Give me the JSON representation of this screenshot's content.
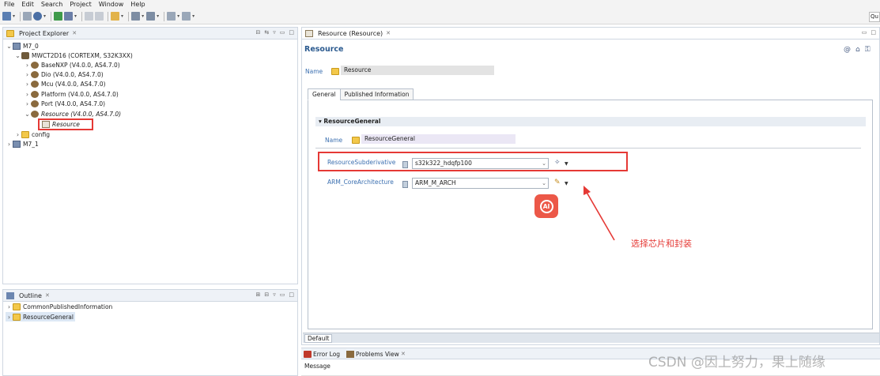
{
  "menubar": {
    "items": [
      "File",
      "Edit",
      "Search",
      "Project",
      "Window",
      "Help"
    ]
  },
  "toolbar": {
    "quick_access": "Qu"
  },
  "project_explorer": {
    "title": "Project Explorer",
    "tree": [
      {
        "label": "M7_0"
      },
      {
        "label": "MWCT2D16 (CORTEXM, S32K3XX)"
      },
      {
        "label": "BaseNXP (V4.0.0, AS4.7.0)"
      },
      {
        "label": "Dio (V4.0.0, AS4.7.0)"
      },
      {
        "label": "Mcu (V4.0.0, AS4.7.0)"
      },
      {
        "label": "Platform (V4.0.0, AS4.7.0)"
      },
      {
        "label": "Port (V4.0.0, AS4.7.0)"
      },
      {
        "label": "Resource (V4.0.0, AS4.7.0)"
      },
      {
        "label": "Resource"
      },
      {
        "label": "config"
      },
      {
        "label": "M7_1"
      }
    ]
  },
  "outline": {
    "title": "Outline",
    "items": [
      {
        "label": "CommonPublishedInformation"
      },
      {
        "label": "ResourceGeneral"
      }
    ]
  },
  "editor": {
    "tab_title": "Resource (Resource)",
    "header_title": "Resource",
    "name_label": "Name",
    "name_value": "Resource",
    "subtabs": [
      "General",
      "Published Information"
    ],
    "section_title": "ResourceGeneral",
    "section_name_label": "Name",
    "section_name_value": "ResourceGeneral",
    "fields": [
      {
        "label": "ResourceSubderivative",
        "value": "s32k322_hdqfp100"
      },
      {
        "label": "ARM_CoreArchitecture",
        "value": "ARM_M_ARCH"
      }
    ],
    "bottom_tab": "Default"
  },
  "annotation": {
    "text": "选择芯片和封装",
    "color": "#e53935"
  },
  "ai_badge": {
    "text": "AI"
  },
  "bottom_panel": {
    "tabs": [
      {
        "label": "Error Log"
      },
      {
        "label": "Problems View"
      }
    ],
    "column_header": "Message"
  },
  "watermark": "CSDN @因上努力，果上随缘"
}
